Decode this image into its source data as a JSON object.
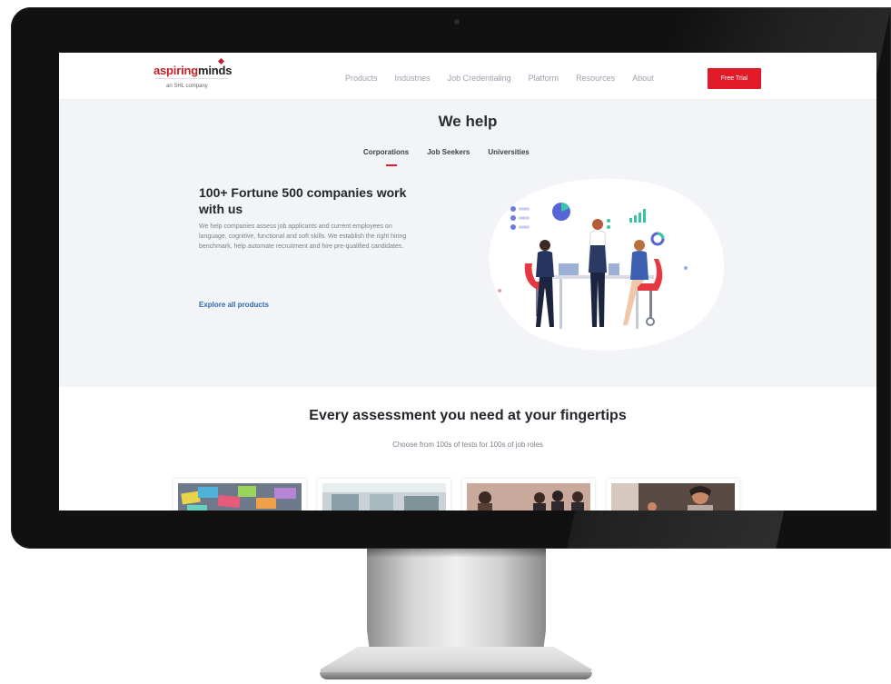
{
  "logo": {
    "main_red": "aspiring",
    "main_dark": "minds",
    "sub": "an SHL company"
  },
  "nav": {
    "items": [
      "Products",
      "Industries",
      "Job Credentialing",
      "Platform",
      "Resources",
      "About"
    ],
    "cta": "Free Trial"
  },
  "hero": {
    "title": "We help",
    "tabs": [
      "Corporations",
      "Job Seekers",
      "Universities"
    ],
    "active_tab": "Corporations",
    "heading": "100+ Fortune 500 companies work with us",
    "body": "We help companies assess job applicants and current employees on language, cognitive, functional and soft skills. We establish the right hiring benchmark, help automate recruitment and hire pre-qualified candidates.",
    "link": "Explore all products"
  },
  "assessments": {
    "title": "Every assessment you need at your fingertips",
    "subtitle": "Choose from 100s of tests for 100s of job roles"
  },
  "colors": {
    "brand_red": "#e01b27",
    "link_blue": "#2b6cb0",
    "hero_bg": "#f3f4f7"
  }
}
